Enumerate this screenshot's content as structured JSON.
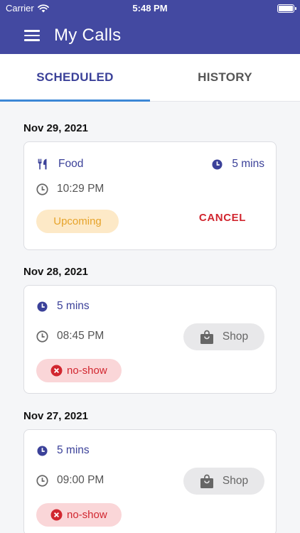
{
  "status_bar": {
    "carrier": "Carrier",
    "time": "5:48 PM"
  },
  "app_bar": {
    "title": "My Calls"
  },
  "tabs": [
    {
      "label": "SCHEDULED",
      "active": true
    },
    {
      "label": "HISTORY",
      "active": false
    }
  ],
  "sections": [
    {
      "date": "Nov 29, 2021",
      "card": {
        "category": "Food",
        "duration": "5 mins",
        "time": "10:29 PM",
        "status": "Upcoming",
        "action": "CANCEL"
      }
    },
    {
      "date": "Nov 28, 2021",
      "card": {
        "duration": "5 mins",
        "time": "08:45 PM",
        "category": "Shop",
        "status": "no-show"
      }
    },
    {
      "date": "Nov 27, 2021",
      "card": {
        "duration": "5 mins",
        "time": "09:00 PM",
        "category": "Shop",
        "status": "no-show"
      }
    }
  ],
  "colors": {
    "primary": "#4349a1",
    "tab_indicator": "#3c87d6",
    "upcoming_bg": "#fde9c7",
    "upcoming_text": "#e6a32a",
    "noshow_bg": "#fad6d8",
    "danger": "#d1262f"
  },
  "icons": {
    "menu": "hamburger-icon",
    "food": "fork-knife-icon",
    "duration": "clock-filled-icon",
    "time": "clock-outline-icon",
    "shop": "shopping-bag-icon",
    "noshow": "x-circle-icon"
  }
}
